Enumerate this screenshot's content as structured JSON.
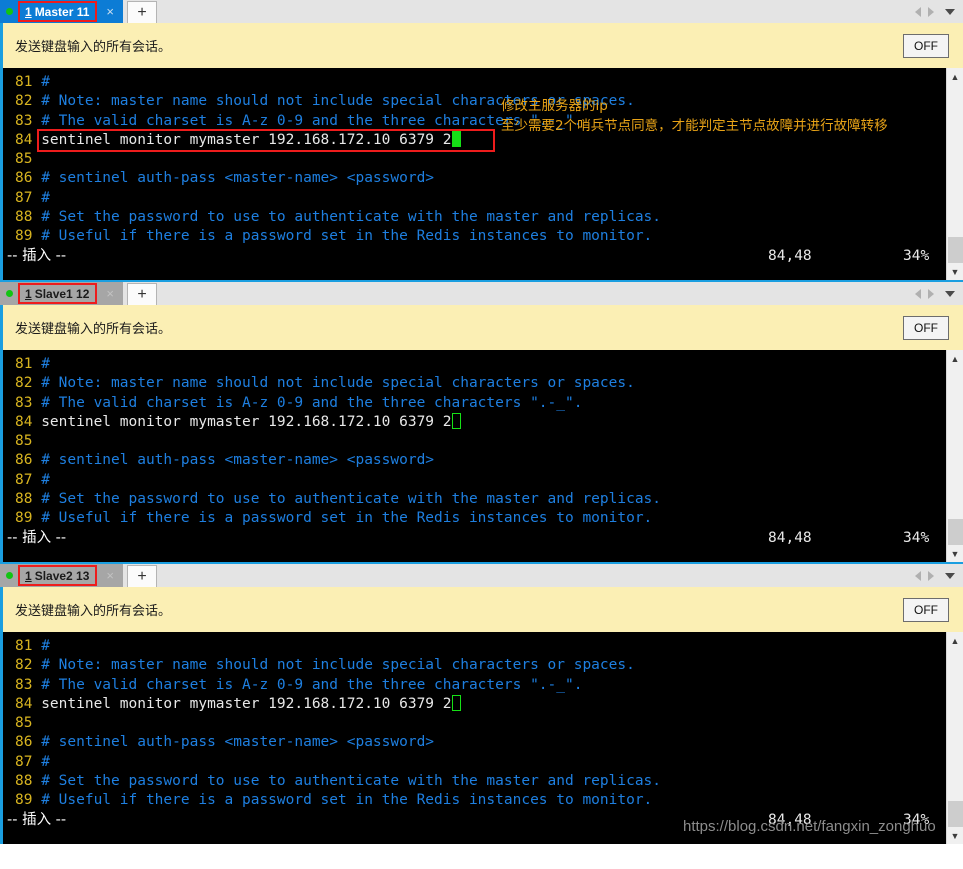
{
  "panels": [
    {
      "tab": {
        "dot": "status-dot",
        "num": "1",
        "title": "Master 11",
        "close": "×",
        "active": true
      },
      "newtab_label": "+",
      "toolbar": {
        "text": "发送键盘输入的所有会话。",
        "toggle_label": "OFF"
      },
      "terminal": {
        "lines": [
          {
            "num": "81",
            "type": "comment",
            "text": "#"
          },
          {
            "num": "82",
            "type": "comment",
            "text": "# Note: master name should not include special characters or spaces."
          },
          {
            "num": "83",
            "type": "comment",
            "text": "# The valid charset is A-z 0-9 and the three characters \".-_\"."
          },
          {
            "num": "84",
            "type": "code",
            "text": "sentinel monitor mymaster 192.168.172.10 6379 2",
            "cursor": "solid",
            "boxed": true
          },
          {
            "num": "85",
            "type": "comment",
            "text": ""
          },
          {
            "num": "86",
            "type": "comment",
            "text": "# sentinel auth-pass <master-name> <password>"
          },
          {
            "num": "87",
            "type": "comment",
            "text": "#"
          },
          {
            "num": "88",
            "type": "comment",
            "text": "# Set the password to use to authenticate with the master and replicas."
          },
          {
            "num": "89",
            "type": "comment",
            "text": "# Useful if there is a password set in the Redis instances to monitor."
          }
        ],
        "status": {
          "mode": "-- 插入 --",
          "position": "84,48",
          "percent": "34%"
        }
      },
      "annotations": [
        "修改主服务器的ip",
        "至少需要2个哨兵节点同意，才能判定主节点故障并进行故障转移"
      ]
    },
    {
      "tab": {
        "dot": "status-dot",
        "num": "1",
        "title": "Slave1 12",
        "close": "×",
        "active": false
      },
      "newtab_label": "+",
      "toolbar": {
        "text": "发送键盘输入的所有会话。",
        "toggle_label": "OFF"
      },
      "terminal": {
        "lines": [
          {
            "num": "81",
            "type": "comment",
            "text": "#"
          },
          {
            "num": "82",
            "type": "comment",
            "text": "# Note: master name should not include special characters or spaces."
          },
          {
            "num": "83",
            "type": "comment",
            "text": "# The valid charset is A-z 0-9 and the three characters \".-_\"."
          },
          {
            "num": "84",
            "type": "code",
            "text": "sentinel monitor mymaster 192.168.172.10 6379 2",
            "cursor": "hollow",
            "boxed": false
          },
          {
            "num": "85",
            "type": "comment",
            "text": ""
          },
          {
            "num": "86",
            "type": "comment",
            "text": "# sentinel auth-pass <master-name> <password>"
          },
          {
            "num": "87",
            "type": "comment",
            "text": "#"
          },
          {
            "num": "88",
            "type": "comment",
            "text": "# Set the password to use to authenticate with the master and replicas."
          },
          {
            "num": "89",
            "type": "comment",
            "text": "# Useful if there is a password set in the Redis instances to monitor."
          }
        ],
        "status": {
          "mode": "-- 插入 --",
          "position": "84,48",
          "percent": "34%"
        }
      },
      "annotations": []
    },
    {
      "tab": {
        "dot": "status-dot",
        "num": "1",
        "title": "Slave2 13",
        "close": "×",
        "active": false
      },
      "newtab_label": "+",
      "toolbar": {
        "text": "发送键盘输入的所有会话。",
        "toggle_label": "OFF"
      },
      "terminal": {
        "lines": [
          {
            "num": "81",
            "type": "comment",
            "text": "#"
          },
          {
            "num": "82",
            "type": "comment",
            "text": "# Note: master name should not include special characters or spaces."
          },
          {
            "num": "83",
            "type": "comment",
            "text": "# The valid charset is A-z 0-9 and the three characters \".-_\"."
          },
          {
            "num": "84",
            "type": "code",
            "text": "sentinel monitor mymaster 192.168.172.10 6379 2",
            "cursor": "hollow",
            "boxed": false
          },
          {
            "num": "85",
            "type": "comment",
            "text": ""
          },
          {
            "num": "86",
            "type": "comment",
            "text": "# sentinel auth-pass <master-name> <password>"
          },
          {
            "num": "87",
            "type": "comment",
            "text": "#"
          },
          {
            "num": "88",
            "type": "comment",
            "text": "# Set the password to use to authenticate with the master and replicas."
          },
          {
            "num": "89",
            "type": "comment",
            "text": "# Useful if there is a password set in the Redis instances to monitor."
          }
        ],
        "status": {
          "mode": "-- 插入 --",
          "position": "84,48",
          "percent": "34%"
        }
      },
      "annotations": []
    }
  ],
  "watermark": "https://blog.csdn.net/fangxin_zonghuo",
  "colors": {
    "tab_active": "#0c7cd5",
    "tab_inactive": "#a6a6a6",
    "toolbar_bg": "#fbefb4",
    "terminal_bg": "#000000",
    "line_number": "#d8b420",
    "comment": "#1e7fe0",
    "code": "#e8e8e8",
    "cursor": "#16e016",
    "highlight_box": "#ee1c1c",
    "annotation": "#e8a317",
    "separator": "#1a9ee0"
  }
}
